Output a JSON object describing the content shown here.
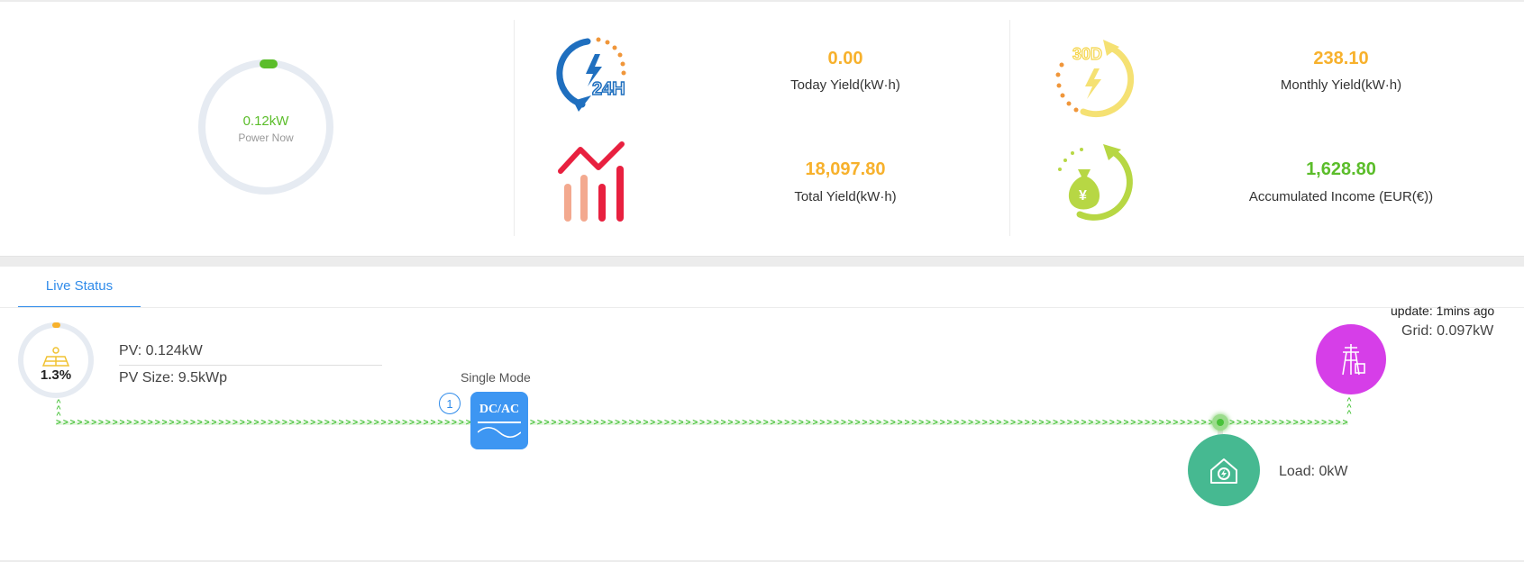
{
  "summary": {
    "power_now": {
      "value": "0.12kW",
      "label": "Power Now",
      "fraction": 0.02
    },
    "today_yield": {
      "value": "0.00",
      "label": "Today Yield(kW·h)",
      "color": "#f7b12c"
    },
    "total_yield": {
      "value": "18,097.80",
      "label": "Total Yield(kW·h)",
      "color": "#f7b12c"
    },
    "monthly_yield": {
      "value": "238.10",
      "label": "Monthly Yield(kW·h)",
      "color": "#f7b12c"
    },
    "accumulated_income": {
      "value": "1,628.80",
      "label": "Accumulated Income (EUR(€))",
      "color": "#5bbd2a"
    },
    "icons": {
      "today": {
        "name": "24h-lightning-icon",
        "text": "24H"
      },
      "monthly": {
        "name": "30d-lightning-icon",
        "text": "30D"
      },
      "total": {
        "name": "bar-trend-chart-icon"
      },
      "income": {
        "name": "money-bag-icon",
        "text": "¥"
      }
    }
  },
  "live": {
    "tab_label": "Live Status",
    "pv": {
      "percent": "1.3%",
      "power": "PV: 0.124kW",
      "size": "PV Size: 9.5kWp"
    },
    "inverter": {
      "mode": "Single Mode",
      "index": "1",
      "label": "DC/AC"
    },
    "grid": {
      "update": "update: 1mins ago",
      "power": "Grid: 0.097kW"
    },
    "load": {
      "power": "Load: 0kW"
    },
    "colors": {
      "flow": "#48c23a",
      "grid": "#d63ee8",
      "load": "#46b991",
      "inverter": "#3d96f2",
      "accent": "#2f8bea"
    }
  }
}
